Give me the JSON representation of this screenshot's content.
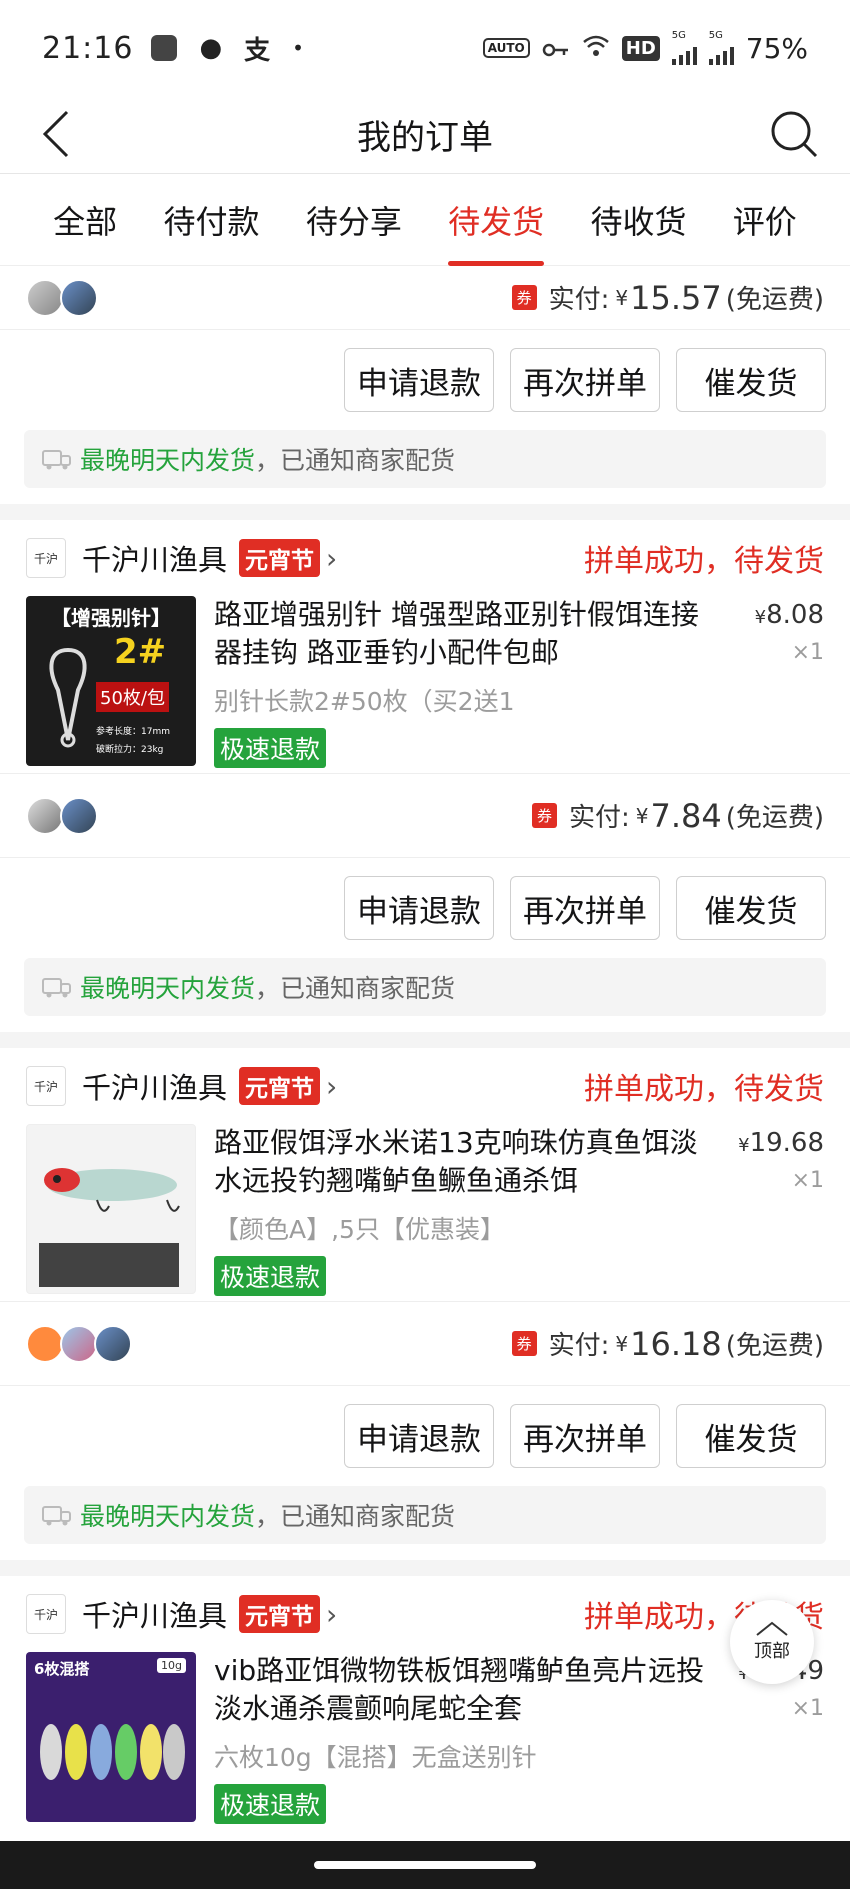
{
  "status_bar": {
    "time": "21:16",
    "battery": "75%",
    "hd": "HD",
    "net1": "5G",
    "net2": "5G",
    "auto_label": "AUTO"
  },
  "nav": {
    "title": "我的订单"
  },
  "tabs": [
    {
      "label": "全部"
    },
    {
      "label": "待付款"
    },
    {
      "label": "待分享"
    },
    {
      "label": "待发货"
    },
    {
      "label": "待收货"
    },
    {
      "label": "评价"
    }
  ],
  "active_tab": "待发货",
  "labels": {
    "coupon": "券",
    "paid": "实付:",
    "yen": "¥",
    "free_shipping": "(免运费)",
    "btn_refund": "申请退款",
    "btn_regroup": "再次拼单",
    "btn_urge": "催发货",
    "notice_green": "最晚明天内发货",
    "notice_rest": "，已通知商家配货",
    "fast_refund": "极速退款",
    "festival": "元宵节",
    "order_state": "拼单成功，待发货",
    "back_to_top": "顶部"
  },
  "orders": [
    {
      "paid": "15.57"
    },
    {
      "shop": "千沪川渔具",
      "goods_name": "路亚增强别针 增强型路亚别针假饵连接器挂钩 路亚垂钓小配件包邮",
      "spec": "别针长款2#50枚（买2送1",
      "price": "8.08",
      "qty": "×1",
      "paid": "7.84",
      "thumb": {
        "title": "【增强别针】",
        "size": "2#",
        "count": "50枚/包",
        "len": "参考长度：17mm",
        "force": "破断拉力：23kg"
      }
    },
    {
      "shop": "千沪川渔具",
      "goods_name": "路亚假饵浮水米诺13克响珠仿真鱼饵淡水远投钓翘嘴鲈鱼鳜鱼通杀饵",
      "spec": "【颜色A】,5只【优惠装】",
      "price": "19.68",
      "qty": "×1",
      "paid": "16.18"
    },
    {
      "shop": "千沪川渔具",
      "goods_name": "vib路亚饵微物铁板饵翘嘴鲈鱼亮片远投淡水通杀震颤响尾蛇全套",
      "spec": "六枚10g【混搭】无盒送别针",
      "price": "15.49",
      "qty": "×1",
      "thumb": {
        "title": "6枚混搭",
        "weight": "10g"
      }
    }
  ],
  "colors": {
    "accent": "#e02e24",
    "green": "#25a33c"
  }
}
